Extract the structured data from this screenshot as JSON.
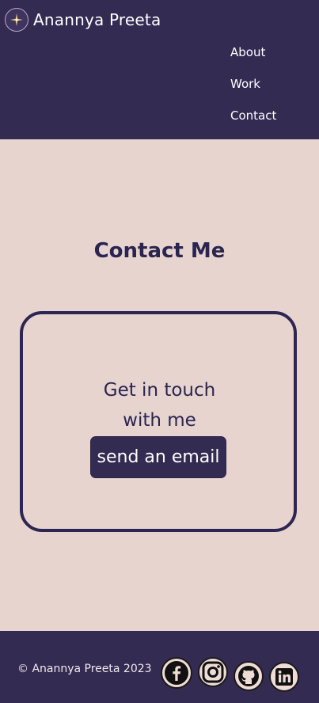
{
  "header": {
    "brand_name": "Anannya Preeta",
    "nav": [
      {
        "label": "About"
      },
      {
        "label": "Work"
      },
      {
        "label": "Contact"
      }
    ]
  },
  "main": {
    "title": "Contact Me",
    "card_text": "Get in touch with me",
    "email_button_label": "send an email"
  },
  "footer": {
    "copyright": "© Anannya Preeta 2023",
    "social": [
      {
        "icon": "facebook-icon"
      },
      {
        "icon": "instagram-icon"
      },
      {
        "icon": "github-icon"
      },
      {
        "icon": "linkedin-icon"
      }
    ]
  },
  "colors": {
    "header_bg": "#342b52",
    "page_bg": "#e7d4cf",
    "text_dark": "#2a2450",
    "icon_bg": "#f0dcd6"
  }
}
